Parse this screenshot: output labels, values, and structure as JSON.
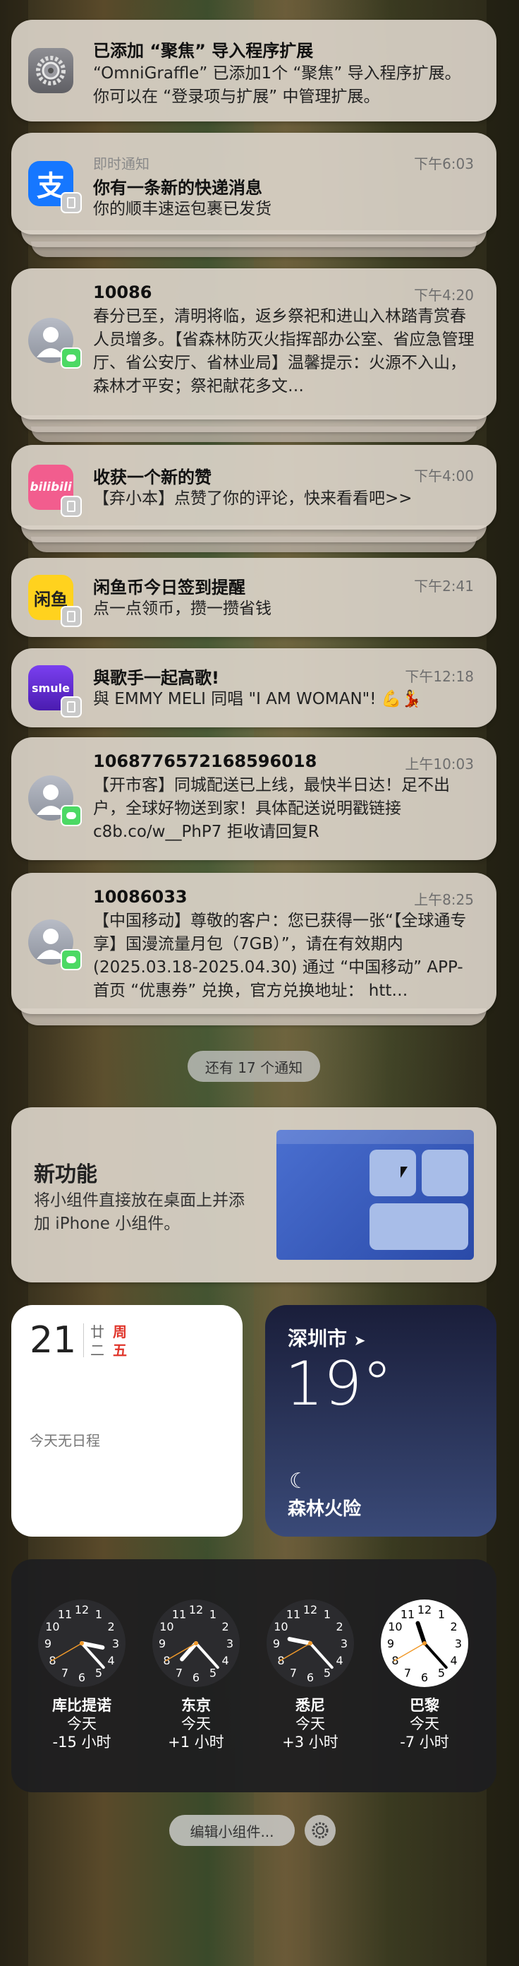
{
  "notifications": [
    {
      "app_icon": "gear-icon",
      "title": "已添加 “聚焦” 导入程序扩展",
      "body": "“OmniGraffle” 已添加1个 “聚焦” 导入程序扩展。 你可以在 “登录项与扩展” 中管理扩展。"
    },
    {
      "app_icon": "alipay-icon",
      "app_name": "即时通知",
      "time": "下午6:03",
      "title": "你有一条新的快递消息",
      "body": "你的顺丰速运包裹已发货"
    },
    {
      "app_icon": "messages-icon",
      "title": "10086",
      "time": "下午4:20",
      "body": "春分已至，清明将临，返乡祭祀和进山入林踏青赏春人员增多。【省森林防灭火指挥部办公室、省应急管理厅、省公安厅、省林业局】温馨提示：火源不入山，森林才平安；祭祀献花多文…"
    },
    {
      "app_icon": "bilibili-icon",
      "title": "收获一个新的赞",
      "time": "下午4:00",
      "body": "【弃小本】点赞了你的评论，快来看看吧>>"
    },
    {
      "app_icon": "xianyu-icon",
      "title": "闲鱼币今日签到提醒",
      "time": "下午2:41",
      "body": "点一点领币，攒一攒省钱"
    },
    {
      "app_icon": "smule-icon",
      "title": "與歌手一起高歌!",
      "time": "下午12:18",
      "body": "與 EMMY MELI 同唱 \"I AM WOMAN\"! 💪💃"
    },
    {
      "app_icon": "messages-icon",
      "title": "10687765721685960​18",
      "time": "上午10:03",
      "body": "【开市客】同城配送已上线，最快半日达！足不出户，全球好物送到家！具体配送说明戳链接 c8b.co/w__PhP7 拒收请回复R"
    },
    {
      "app_icon": "messages-icon",
      "title": "10086033",
      "time": "上午8:25",
      "body": "【中国移动】尊敬的客户：您已获得一张“【全球通专享】国漫流量月包（7GB）”，请在有效期内(2025.03.18-2025.04.30) 通过 “中国移动” APP-首页 “优惠券” 兑换，官方兑换地址： htt…"
    }
  ],
  "more_notifications": "还有 17 个通知",
  "new_feature": {
    "title": "新功能",
    "body": "将小组件直接放在桌面上并添加 iPhone 小组件。"
  },
  "calendar": {
    "day": "21",
    "lunar_top": "廿",
    "lunar_bottom": "二",
    "weekday_top": "周",
    "weekday_bottom": "五",
    "empty_text": "今天无日程"
  },
  "weather": {
    "city": "深圳市",
    "temperature": "19°",
    "condition_icon": "moon-icon",
    "alert": "森林火险"
  },
  "world_clocks": [
    {
      "city": "库比提诺",
      "day": "今天",
      "offset": "-15 小时",
      "hour": 3,
      "minute": 23,
      "theme": "dark"
    },
    {
      "city": "东京",
      "day": "今天",
      "offset": "+1 小时",
      "hour": 7,
      "minute": 23,
      "theme": "dark"
    },
    {
      "city": "悉尼",
      "day": "今天",
      "offset": "+3 小时",
      "hour": 9,
      "minute": 23,
      "theme": "dark"
    },
    {
      "city": "巴黎",
      "day": "今天",
      "offset": "-7 小时",
      "hour": 11,
      "minute": 23,
      "theme": "light"
    }
  ],
  "edit_widgets": "编辑小组件...",
  "colors": {
    "accent_blue": "#2f6fe8",
    "weekday_red": "#e0352b",
    "messages_green": "#4cd964",
    "bilibili_pink": "#f25d8e",
    "xianyu_yellow": "#ffd21e",
    "smule_purple": "#6b2bd8"
  }
}
